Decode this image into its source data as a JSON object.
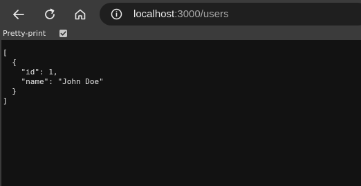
{
  "browser": {
    "back_icon": "arrow-left-icon",
    "reload_icon": "reload-icon",
    "home_icon": "home-icon",
    "info_icon": "info-circle-icon",
    "url_host": "localhost",
    "url_path": ":3000/users"
  },
  "viewer": {
    "pretty_print_label": "Pretty-print",
    "pretty_print_checked": true,
    "lines": [
      "[",
      "  {",
      "    \"id\": 1,",
      "    \"name\": \"John Doe\"",
      "  }",
      "]"
    ]
  }
}
